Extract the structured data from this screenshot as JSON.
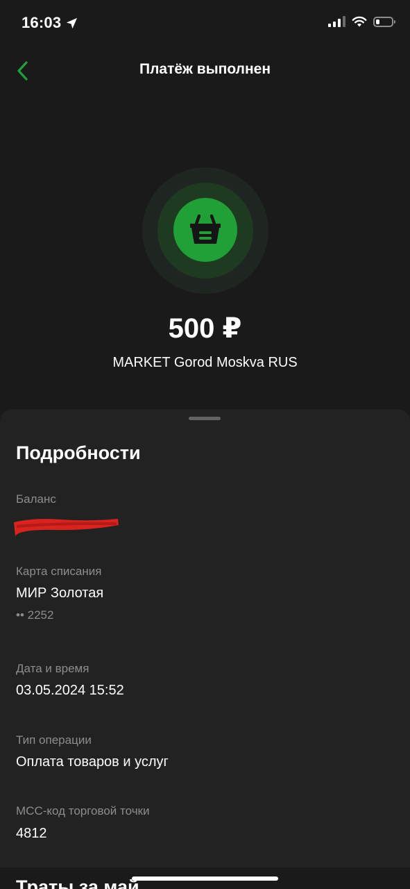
{
  "status_bar": {
    "time": "16:03",
    "battery_percent": 25
  },
  "nav": {
    "title": "Платёж выполнен"
  },
  "payment": {
    "amount": "500 ₽",
    "merchant": "MARKET Gorod Moskva RUS",
    "category_icon": "shopping-basket-icon"
  },
  "details": {
    "title": "Подробности",
    "balance_label": "Баланс",
    "card_label": "Карта списания",
    "card_name": "МИР Золотая",
    "card_number": "•• 2252",
    "datetime_label": "Дата и время",
    "datetime_value": "03.05.2024 15:52",
    "operation_type_label": "Тип операции",
    "operation_type_value": "Оплата товаров и услуг",
    "mcc_label": "MCC-код торговой точки",
    "mcc_value": "4812"
  },
  "next_section": {
    "title": "Траты за май"
  },
  "colors": {
    "accent": "#21a038",
    "background": "#1a1a1a",
    "sheet": "#222222",
    "muted_text": "#8d8d8d",
    "redaction": "#d9231f"
  }
}
